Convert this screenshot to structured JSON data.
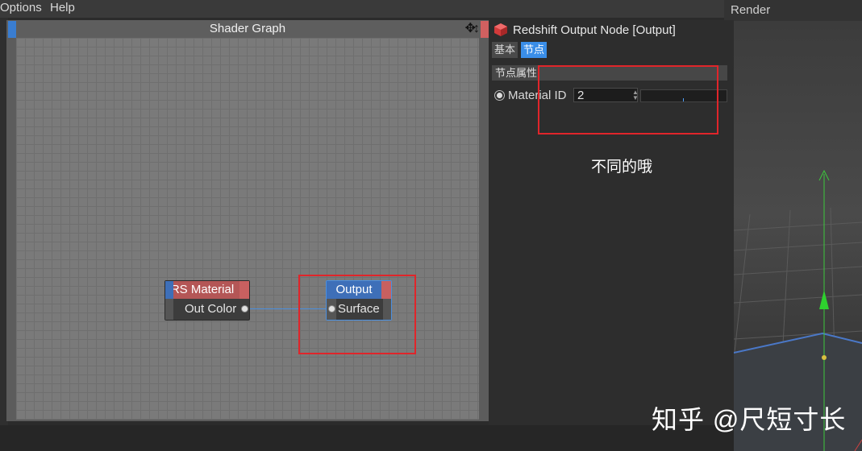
{
  "menu": {
    "options": "Options",
    "help": "Help"
  },
  "viewport": {
    "header": "Render"
  },
  "shader_graph": {
    "title": "Shader Graph",
    "arrows_glyph": "✥↕",
    "nodes": {
      "rs_material": {
        "title": "RS Material",
        "port": "Out Color",
        "header_color": "#b45656"
      },
      "output": {
        "title": "Output",
        "port": "Surface",
        "header_color": "#3e6fb8"
      }
    }
  },
  "properties": {
    "title": "Redshift Output Node [Output]",
    "tabs": {
      "basic": "基本",
      "node": "节点"
    },
    "section": "节点属性",
    "material_id": {
      "label": "Material ID",
      "value": "2"
    },
    "note": "不同的哦"
  },
  "watermark": "知乎 @尺短寸长",
  "colors": {
    "accent": "#3a8ee8",
    "highlight": "#e0252a"
  }
}
